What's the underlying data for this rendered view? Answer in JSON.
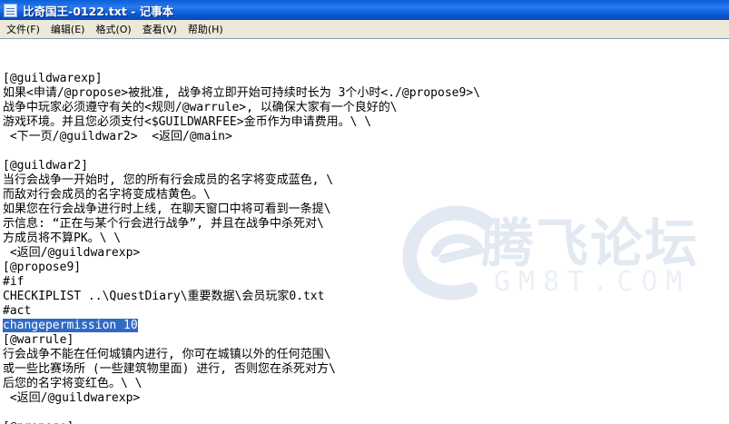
{
  "window": {
    "title": "比奇国王-0122.txt - 记事本"
  },
  "menu": {
    "items": [
      {
        "label": "文件(F)",
        "name": "menu-file"
      },
      {
        "label": "编辑(E)",
        "name": "menu-edit"
      },
      {
        "label": "格式(O)",
        "name": "menu-format"
      },
      {
        "label": "查看(V)",
        "name": "menu-view"
      },
      {
        "label": "帮助(H)",
        "name": "menu-help"
      }
    ]
  },
  "editor": {
    "lines": [
      {
        "text": "",
        "selected": "",
        "after": ""
      },
      {
        "text": "[@guildwarexp]",
        "selected": "",
        "after": ""
      },
      {
        "text": "如果<申请/@propose>被批准, 战争将立即开始可持续时长为 3个小时<./@propose9>\\",
        "selected": "",
        "after": ""
      },
      {
        "text": "战争中玩家必须遵守有关的<规则/@warrule>, 以确保大家有一个良好的\\",
        "selected": "",
        "after": ""
      },
      {
        "text": "游戏环境。并且您必须支付<$GUILDWARFEE>金币作为申请费用。\\ \\",
        "selected": "",
        "after": ""
      },
      {
        "text": " <下一页/@guildwar2>  <返回/@main>",
        "selected": "",
        "after": ""
      },
      {
        "text": "",
        "selected": "",
        "after": ""
      },
      {
        "text": "[@guildwar2]",
        "selected": "",
        "after": ""
      },
      {
        "text": "当行会战争一开始时, 您的所有行会成员的名字将变成蓝色, \\",
        "selected": "",
        "after": ""
      },
      {
        "text": "而敌对行会成员的名字将变成桔黄色。\\",
        "selected": "",
        "after": ""
      },
      {
        "text": "如果您在行会战争进行时上线, 在聊天窗口中将可看到一条提\\",
        "selected": "",
        "after": ""
      },
      {
        "text": "示信息: “正在与某个行会进行战争”, 并且在战争中杀死对\\",
        "selected": "",
        "after": ""
      },
      {
        "text": "方成员将不算PK。\\ \\",
        "selected": "",
        "after": ""
      },
      {
        "text": " <返回/@guildwarexp>",
        "selected": "",
        "after": ""
      },
      {
        "text": "[@propose9]",
        "selected": "",
        "after": ""
      },
      {
        "text": "#if",
        "selected": "",
        "after": ""
      },
      {
        "text": "CHECKIPLIST ..\\QuestDiary\\重要数据\\会员玩家0.txt",
        "selected": "",
        "after": ""
      },
      {
        "text": "#act",
        "selected": "",
        "after": ""
      },
      {
        "text": "",
        "selected": "changepermission 10",
        "after": ""
      },
      {
        "text": "[@warrule]",
        "selected": "",
        "after": ""
      },
      {
        "text": "行会战争不能在任何城镇内进行, 你可在城镇以外的任何范围\\",
        "selected": "",
        "after": ""
      },
      {
        "text": "或一些比赛场所 (一些建筑物里面) 进行, 否则您在杀死对方\\",
        "selected": "",
        "after": ""
      },
      {
        "text": "后您的名字将变红色。\\ \\",
        "selected": "",
        "after": ""
      },
      {
        "text": " <返回/@guildwarexp>",
        "selected": "",
        "after": ""
      },
      {
        "text": "",
        "selected": "",
        "after": ""
      },
      {
        "text": "[@propose]",
        "selected": "",
        "after": ""
      }
    ]
  },
  "watermark": {
    "chinese": "腾飞论坛",
    "english": "GM8T.COM"
  },
  "colors": {
    "titlebar": "#0b5ad6",
    "menubar": "#ece9d8",
    "selection": "#316ac5"
  }
}
